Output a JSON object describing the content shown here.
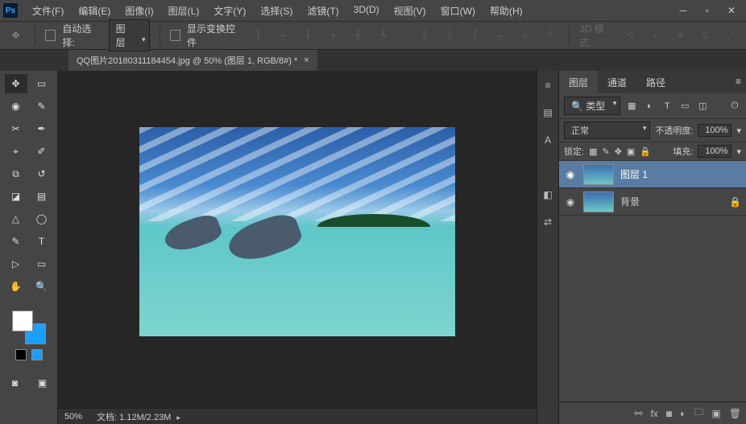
{
  "app": {
    "logo": "Ps"
  },
  "menu": [
    "文件(F)",
    "编辑(E)",
    "图像(I)",
    "图层(L)",
    "文字(Y)",
    "选择(S)",
    "滤镜(T)",
    "3D(D)",
    "视图(V)",
    "窗口(W)",
    "帮助(H)"
  ],
  "options": {
    "auto_select": "自动选择:",
    "auto_select_mode": "图层",
    "show_transform": "显示变换控件",
    "mode_3d": "3D 模式:"
  },
  "document": {
    "tab_title": "QQ图片20180311184454.jpg @ 50% (图层 1, RGB/8#) *",
    "zoom": "50%",
    "doc_label": "文档:",
    "doc_size": "1.12M/2.23M"
  },
  "panels": {
    "tabs": [
      "图层",
      "通道",
      "路径"
    ],
    "filter_kind": "类型",
    "blend_mode": "正常",
    "opacity_label": "不透明度:",
    "opacity_value": "100%",
    "lock_label": "锁定:",
    "fill_label": "填充:",
    "fill_value": "100%",
    "layers": [
      {
        "name": "图层 1",
        "visible": true,
        "locked": false,
        "selected": true
      },
      {
        "name": "背景",
        "visible": true,
        "locked": true,
        "selected": false
      }
    ]
  }
}
